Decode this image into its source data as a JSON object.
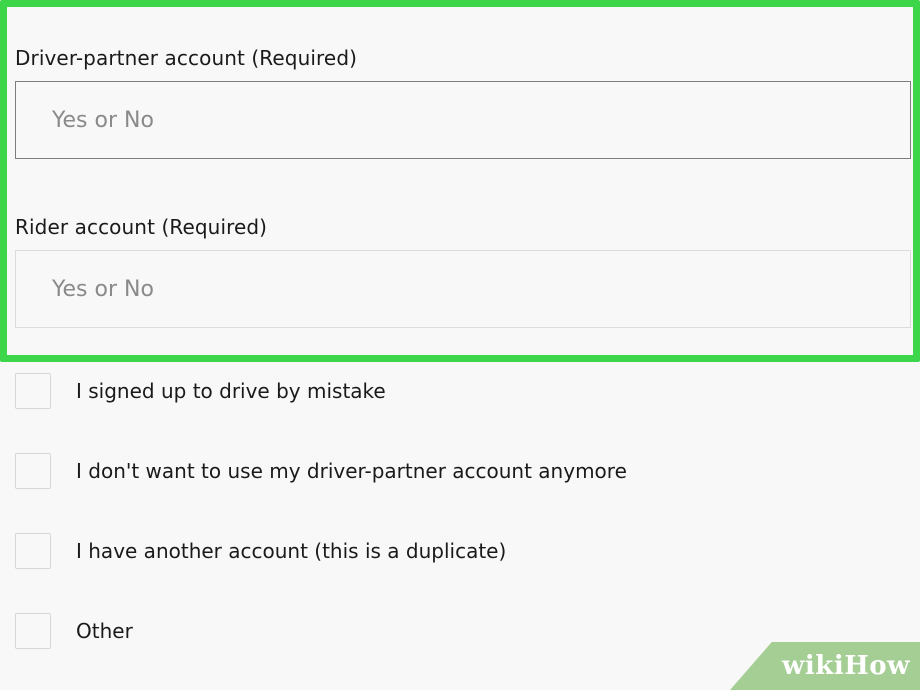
{
  "form": {
    "driver_partner": {
      "label": "Driver-partner account (Required)",
      "placeholder": "Yes or No",
      "value": ""
    },
    "rider": {
      "label": "Rider account (Required)",
      "placeholder": "Yes or No",
      "value": ""
    },
    "reasons": [
      {
        "label": "I signed up to drive by mistake",
        "checked": false
      },
      {
        "label": "I don't want to use my driver-partner account anymore",
        "checked": false
      },
      {
        "label": "I have another account (this is a duplicate)",
        "checked": false
      },
      {
        "label": "Other",
        "checked": false
      }
    ]
  },
  "highlight": {
    "color": "#3dd64a"
  },
  "watermark": {
    "text": "wikiHow"
  }
}
